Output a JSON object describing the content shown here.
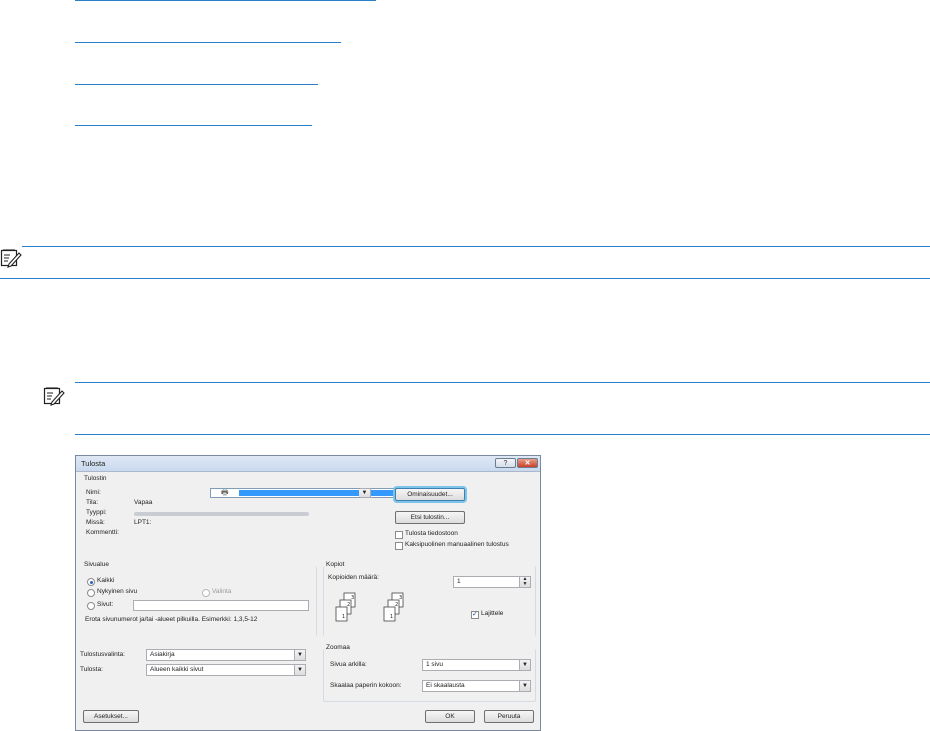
{
  "dialog": {
    "title": "Tulosta",
    "help_label": "?",
    "close_label": "✕",
    "printer": {
      "group_label": "Tulostin",
      "name_label": "Nimi:",
      "status_label": "Tila:",
      "status_value": "Vapaa",
      "type_label": "Tyyppi:",
      "where_label": "Missä:",
      "where_value": "LPT1:",
      "comment_label": "Kommentti:",
      "properties_button": "Ominaisuudet...",
      "find_printer_button": "Etsi tulostin...",
      "print_to_file": "Tulosta tiedostoon",
      "manual_duplex": "Kaksipuolinen manuaalinen tulostus"
    },
    "page_range": {
      "group_label": "Sivualue",
      "all": "Kaikki",
      "current_page": "Nykyinen sivu",
      "selection": "Valinta",
      "pages": "Sivut:",
      "hint": "Erota sivunumerot ja/tai -alueet pilkuilla. Esimerkki: 1,3,5-12"
    },
    "copies": {
      "group_label": "Kopiot",
      "count_label": "Kopioiden määrä:",
      "count_value": "1",
      "collate": "Lajittele"
    },
    "print_what": {
      "label": "Tulostusvalinta:",
      "value": "Asiakirja"
    },
    "print": {
      "label": "Tulosta:",
      "value": "Alueen kaikki sivut"
    },
    "zoom": {
      "group_label": "Zoomaa",
      "pages_per_sheet_label": "Sivua arkilla:",
      "pages_per_sheet_value": "1 sivu",
      "scale_label": "Skaalaa paperin kokoon:",
      "scale_value": "Ei skaalausta"
    },
    "options_button": "Asetukset...",
    "ok_button": "OK",
    "cancel_button": "Peruuta"
  },
  "icons": {
    "note_icon": "note-pencil-icon",
    "dropdown_icon": "chevron-down-icon",
    "spinner_icon": "up-down-spinner-icon"
  },
  "colors": {
    "link_rule": "#2a7fc8",
    "selection": "#3399ff",
    "close_red": "#c8402a"
  }
}
